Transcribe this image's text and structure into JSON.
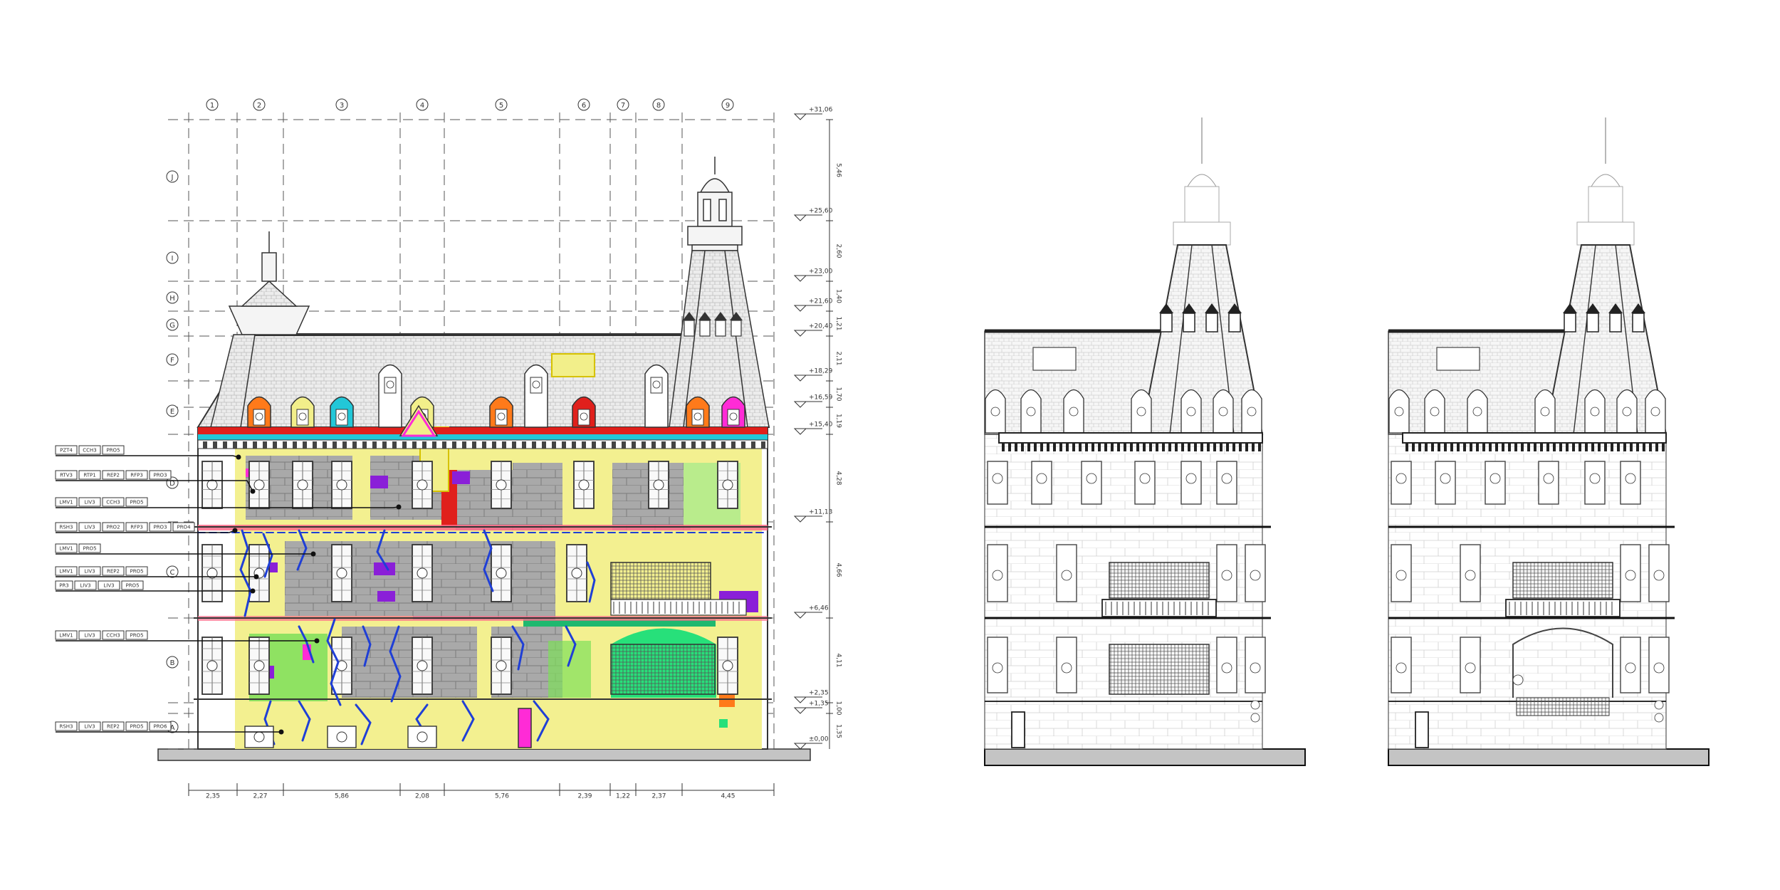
{
  "axes_columns": [
    "1",
    "2",
    "3",
    "4",
    "5",
    "6",
    "7",
    "8",
    "9"
  ],
  "axes_rows": [
    "J",
    "I",
    "H",
    "G",
    "F",
    "E",
    "D",
    "C",
    "B",
    "A"
  ],
  "levels": [
    "+31,06",
    "+25,60",
    "+23,00",
    "+21,60",
    "+20,40",
    "+18,29",
    "+16,59",
    "+15,40",
    "+11,13",
    "+6,46",
    "+2,35",
    "+1,35",
    "±0,00"
  ],
  "dims_vertical": [
    "5,46",
    "2,60",
    "1,40",
    "1,21",
    "2,11",
    "1,70",
    "1,19",
    "4,28",
    "4,66",
    "4,11",
    "1,00",
    "1,35"
  ],
  "dims_horizontal": [
    "2,35",
    "2,27",
    "5,86",
    "2,08",
    "5,76",
    "2,39",
    "1,22",
    "2,37",
    "4,45"
  ],
  "legend_rows": [
    [
      "PZT4",
      "CCH3",
      "PRO5"
    ],
    [
      "RTV3",
      "RTP1",
      "REP2",
      "RFP3",
      "PRO3"
    ],
    [
      "LMV1",
      "LIV3",
      "CCH3",
      "PRO5"
    ],
    [
      "RSH3",
      "LIV3",
      "PRO2",
      "RFP3",
      "PRO3",
      "PRO4"
    ],
    [
      "LMV1",
      "PRO5"
    ],
    [
      "LMV1",
      "LIV3",
      "REP2",
      "PRO5"
    ],
    [
      "PR3",
      "LIV3",
      "LIV3",
      "PRO5"
    ],
    [
      "LMV1",
      "LIV3",
      "CCH3",
      "PRO5"
    ],
    [
      "RSH3",
      "LIV3",
      "REP2",
      "PRO5",
      "PRO6"
    ]
  ],
  "colors": {
    "line": "#333333",
    "roof": "#e8e8e8",
    "stone_grey": "#a9a9a9",
    "highlight_yellow": "#f2ef8a",
    "crack_blue": "#1f3fd6",
    "green_zone": "#7ddf5a",
    "bright_green": "#27e07a",
    "purple": "#8a1fd8",
    "magenta": "#ff2bd6",
    "red": "#e0201c",
    "orange": "#ff7a1a",
    "cyan": "#22c7d8",
    "ground": "#c4c4c4"
  }
}
